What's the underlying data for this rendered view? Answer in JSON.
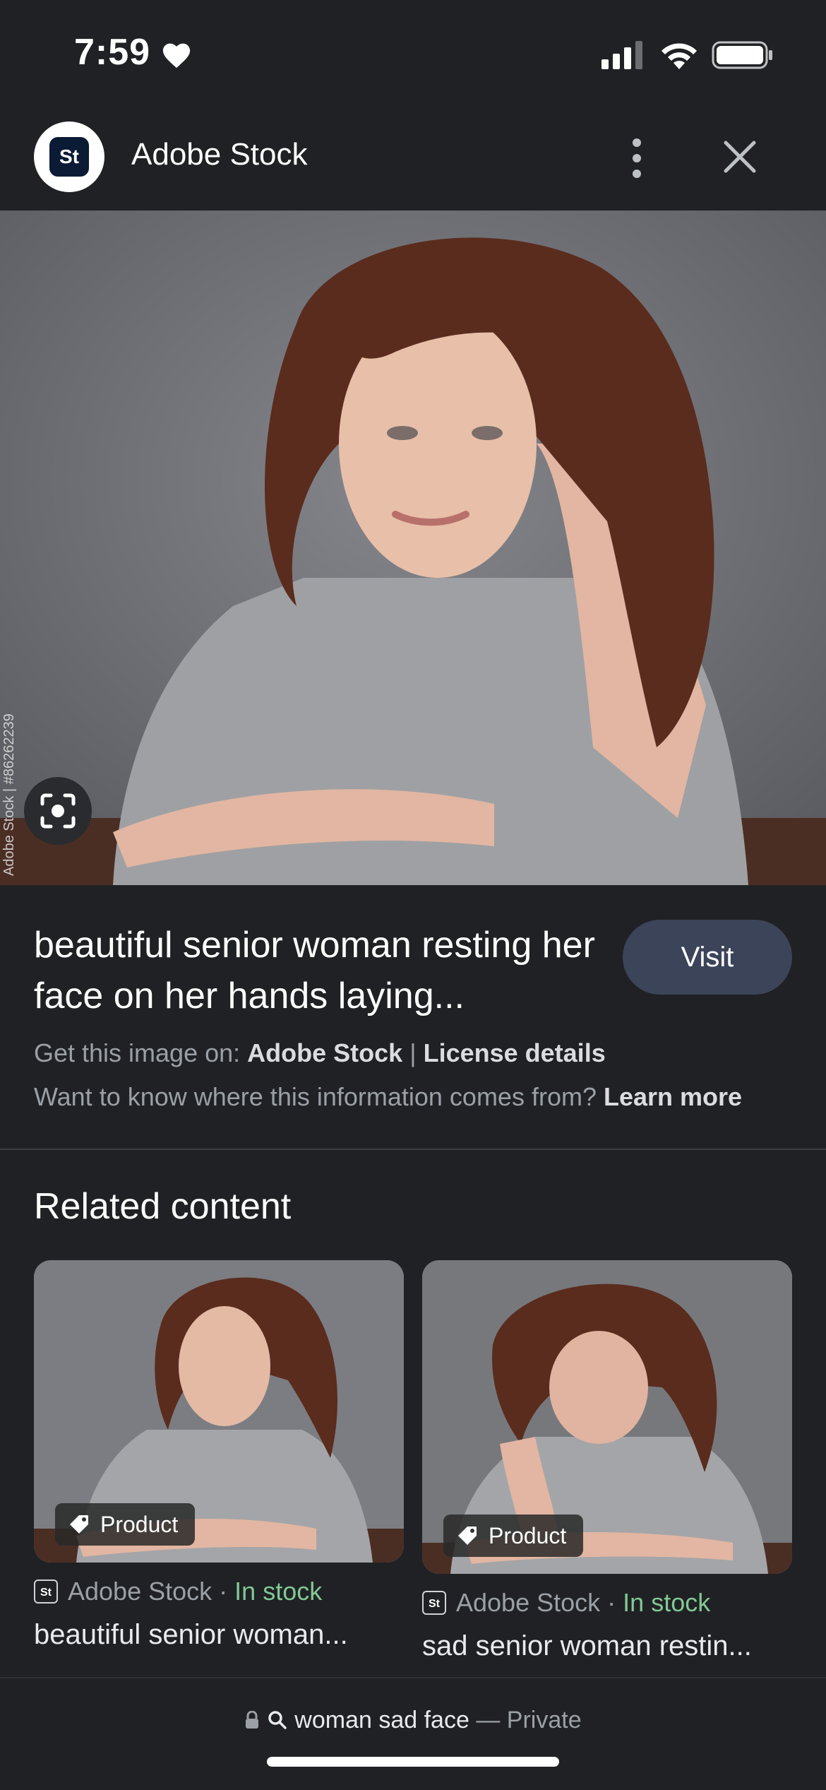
{
  "status_bar": {
    "time": "7:59"
  },
  "header": {
    "site_name": "Adobe Stock",
    "logo_text": "St"
  },
  "main_image": {
    "watermark_id": "Adobe Stock | #86262239",
    "watermark_text": "Adobe Stock"
  },
  "details": {
    "title": "beautiful senior woman resting her face on her hands laying...",
    "visit_label": "Visit",
    "get_image_prefix": "Get this image on:",
    "get_image_source": "Adobe Stock",
    "separator": "|",
    "license_label": "License details",
    "info_question": "Want to know where this information comes from?",
    "learn_more": "Learn more"
  },
  "related": {
    "heading": "Related content",
    "cards": [
      {
        "chip": "Product",
        "source": "Adobe Stock",
        "dot": "·",
        "stock": "In stock",
        "caption": "beautiful senior woman..."
      },
      {
        "chip": "Product",
        "source": "Adobe Stock",
        "dot": "·",
        "stock": "In stock",
        "caption": "sad senior woman restin..."
      }
    ]
  },
  "bottom_bar": {
    "query": "woman sad face",
    "dash": "—",
    "private_label": "Private"
  },
  "colors": {
    "background": "#202124",
    "visit_button": "#3c4459",
    "in_stock": "#81c995"
  },
  "icons": [
    "heart-icon",
    "signal-icon",
    "wifi-icon",
    "battery-icon",
    "more-vert-icon",
    "close-icon",
    "lens-icon",
    "tag-icon",
    "lock-icon",
    "search-icon"
  ]
}
